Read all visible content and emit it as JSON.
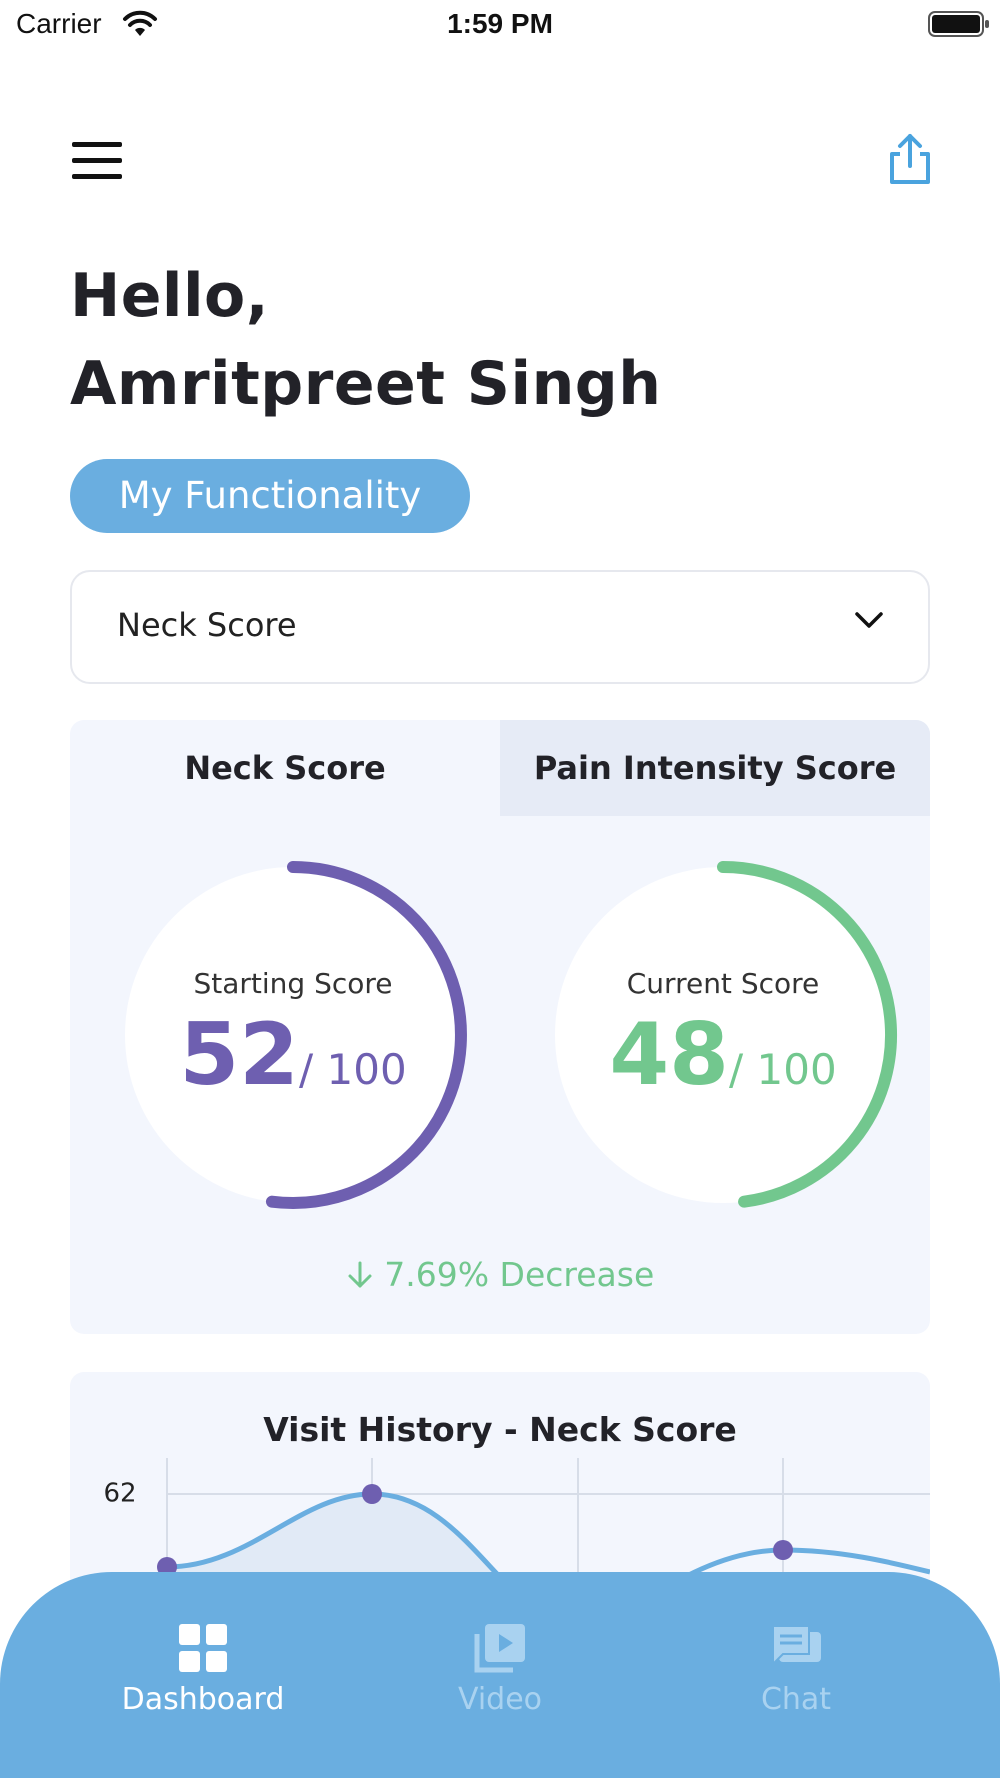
{
  "status_bar": {
    "carrier": "Carrier",
    "time": "1:59 PM"
  },
  "header": {
    "menu_icon": "hamburger-menu-icon",
    "share_icon": "share-icon"
  },
  "greeting": {
    "line1": "Hello,",
    "line2": "Amritpreet Singh"
  },
  "functionality_button": "My Functionality",
  "score_select": {
    "value": "Neck Score",
    "icon": "chevron-down-icon"
  },
  "score_tabs": [
    {
      "label": "Neck Score",
      "selected": true
    },
    {
      "label": "Pain Intensity Score",
      "selected": false
    }
  ],
  "gauges": {
    "starting": {
      "label": "Starting Score",
      "value": "52",
      "max": "/ 100",
      "score": 52,
      "total": 100,
      "color": "#6e5fb0"
    },
    "current": {
      "label": "Current Score",
      "value": "48",
      "max": "/ 100",
      "score": 48,
      "total": 100,
      "color": "#72c78e"
    }
  },
  "change": {
    "text": "7.69% Decrease",
    "icon": "arrow-down-icon",
    "color": "#72c78e"
  },
  "visit_history": {
    "title": "Visit History  - Neck Score",
    "y_tick": "62"
  },
  "chart_data": {
    "type": "area",
    "title": "Visit History  - Neck Score",
    "y_ticks_visible": [
      "62"
    ],
    "points_visible": [
      {
        "index": 0,
        "y": 58
      },
      {
        "index": 1,
        "y": 62
      },
      {
        "index": 3,
        "y": 59
      }
    ],
    "series_color": "#6aaee0",
    "point_color": "#6e5fb0",
    "grid": true
  },
  "bottom_nav": [
    {
      "label": "Dashboard",
      "icon": "dashboard-icon",
      "active": true
    },
    {
      "label": "Video",
      "icon": "video-icon",
      "active": false
    },
    {
      "label": "Chat",
      "icon": "chat-icon",
      "active": false
    }
  ],
  "colors": {
    "accent": "#6aaee0",
    "purple": "#6e5fb0",
    "green": "#72c78e",
    "card_bg": "#f3f6fd"
  }
}
